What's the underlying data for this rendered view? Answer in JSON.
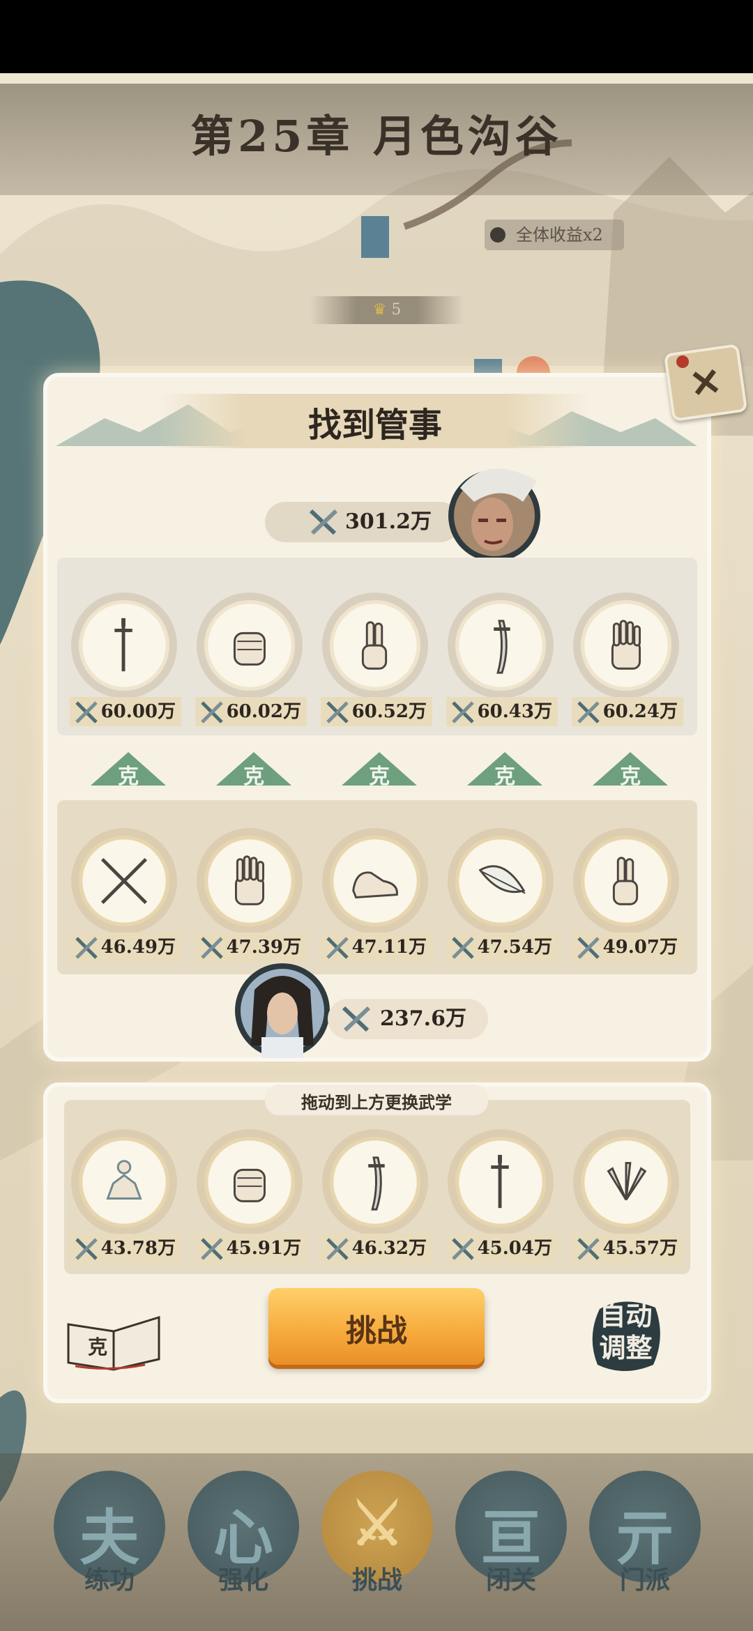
{
  "header": {
    "chapter_title": "第25章 月色沟谷",
    "bonus": "全体收益x2",
    "stars": "5"
  },
  "dialog": {
    "title": "找到管事",
    "close_glyph": "✕",
    "enemy_power": "301.2万",
    "enemy_slots": [
      {
        "icon": "sword-icon",
        "power": "60.00万"
      },
      {
        "icon": "fist-icon",
        "power": "60.02万"
      },
      {
        "icon": "finger-icon",
        "power": "60.52万"
      },
      {
        "icon": "sabre-icon",
        "power": "60.43万"
      },
      {
        "icon": "palm-icon",
        "power": "60.24万"
      }
    ],
    "counter_label": "克",
    "player_slots": [
      {
        "icon": "crossed-brush-icon",
        "power": "46.49万"
      },
      {
        "icon": "palm-icon",
        "power": "47.39万"
      },
      {
        "icon": "shoe-icon",
        "power": "47.11万"
      },
      {
        "icon": "feather-icon",
        "power": "47.54万"
      },
      {
        "icon": "finger-icon",
        "power": "49.07万"
      }
    ],
    "player_power": "237.6万"
  },
  "bag": {
    "hint": "拖动到上方更换武学",
    "slots": [
      {
        "icon": "meditate-icon",
        "power": "43.78万"
      },
      {
        "icon": "fist-icon",
        "power": "45.91万"
      },
      {
        "icon": "sabre-icon",
        "power": "46.32万"
      },
      {
        "icon": "sword-icon",
        "power": "45.04万"
      },
      {
        "icon": "throwing-knives-icon",
        "power": "45.57万"
      }
    ],
    "challenge_label": "挑战",
    "auto_label_1": "自动",
    "auto_label_2": "调整",
    "book_glyph": "克"
  },
  "nav": [
    {
      "label": "练功",
      "glyph": "夫",
      "active": false
    },
    {
      "label": "强化",
      "glyph": "心",
      "active": false
    },
    {
      "label": "挑战",
      "glyph": "⚔",
      "active": true
    },
    {
      "label": "闭关",
      "glyph": "亘",
      "active": false
    },
    {
      "label": "门派",
      "glyph": "亓",
      "active": false
    }
  ]
}
